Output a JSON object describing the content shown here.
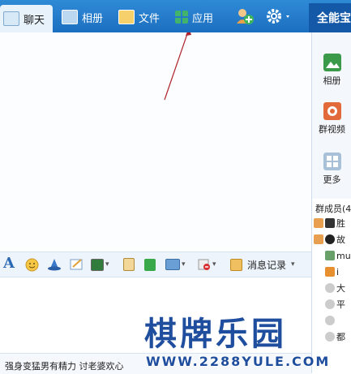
{
  "tabs": [
    {
      "label": "聊天",
      "icon": "chat-icon",
      "active": true
    },
    {
      "label": "相册",
      "icon": "album-icon",
      "active": false
    },
    {
      "label": "文件",
      "icon": "folder-icon",
      "active": false
    },
    {
      "label": "应用",
      "icon": "apps-icon",
      "active": false
    }
  ],
  "topbar": {
    "add_member_icon": "add-member-icon",
    "settings_icon": "gear-icon",
    "brand_text": "全能宝"
  },
  "toolbar": {
    "icons": [
      "font-icon",
      "smiley-icon",
      "magic-hat-icon",
      "scribble-icon",
      "image-icon",
      "note-icon",
      "money-icon",
      "screenshot-icon",
      "block-icon",
      "history-icon"
    ],
    "history_label": "消息记录"
  },
  "sidebar": {
    "items": [
      {
        "label": "相册",
        "icon": "album-icon"
      },
      {
        "label": "群视频",
        "icon": "video-icon"
      },
      {
        "label": "更多",
        "icon": "more-icon"
      }
    ]
  },
  "members": {
    "header": "群成员(4",
    "items": [
      {
        "label": "胜"
      },
      {
        "label": "故"
      },
      {
        "label": "mu"
      },
      {
        "label": "i"
      },
      {
        "label": "大"
      },
      {
        "label": "平"
      },
      {
        "label": ""
      },
      {
        "label": "都"
      }
    ]
  },
  "status": {
    "text": "强身变猛男有精力 讨老婆欢心"
  },
  "watermark": {
    "title": "棋牌乐园",
    "url": "WWW.2288YULE.COM"
  },
  "colors": {
    "topbar": "#1c6fc0",
    "arrow": "#b0222a",
    "watermark": "#1f4e9e"
  }
}
